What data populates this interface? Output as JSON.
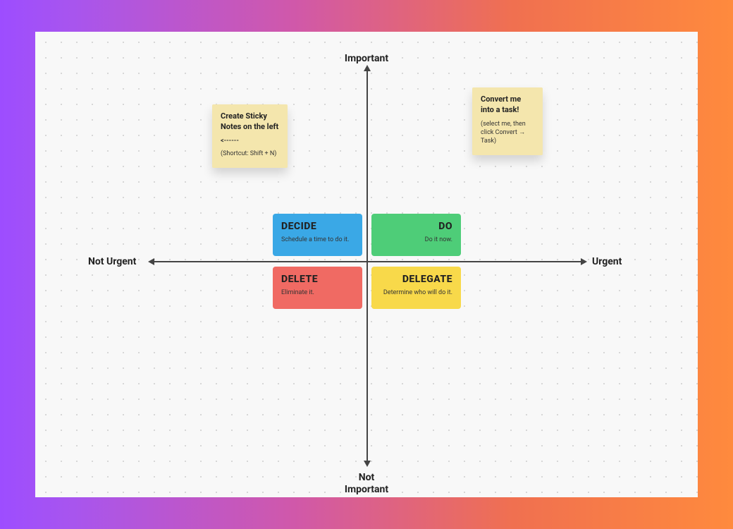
{
  "axes": {
    "top": "Important",
    "bottom": "Not\nImportant",
    "left": "Not Urgent",
    "right": "Urgent"
  },
  "quadrants": {
    "decide": {
      "title": "DECIDE",
      "subtitle": "Schedule a time to do it.",
      "color": "#3aa8e6"
    },
    "do": {
      "title": "DO",
      "subtitle": "Do it now.",
      "color": "#4ecd78"
    },
    "delete": {
      "title": "DELETE",
      "subtitle": "Eliminate it.",
      "color": "#f06a63"
    },
    "delegate": {
      "title": "DELEGATE",
      "subtitle": "Determine who will do it.",
      "color": "#f8d94a"
    }
  },
  "stickies": {
    "left": {
      "title": "Create Sticky Notes on the left",
      "arrow": "<------",
      "detail": "(Shortcut: Shift + N)"
    },
    "right": {
      "title": "Convert me into a task!",
      "detail": "(select me, then click Convert → Task)"
    }
  }
}
